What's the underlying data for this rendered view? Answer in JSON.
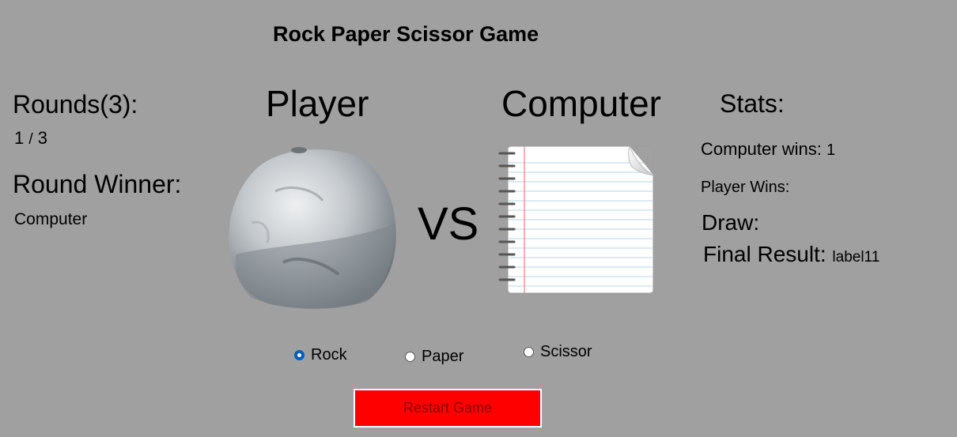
{
  "window": {
    "title": "Rock Paper Scissor Game"
  },
  "left_panel": {
    "rounds_label": "Rounds(3):",
    "rounds_current": "1",
    "rounds_separator": "/",
    "rounds_total": "3",
    "round_winner_label": "Round Winner:",
    "round_winner_value": "Computer"
  },
  "arena": {
    "player_heading": "Player",
    "computer_heading": "Computer",
    "vs_label": "VS",
    "player_choice_image": "rock-image",
    "computer_choice_image": "paper-notepad-image"
  },
  "stats": {
    "heading": "Stats:",
    "computer_wins_label": "Computer wins:",
    "computer_wins_value": "1",
    "player_wins_label": "Player Wins:",
    "player_wins_value": "",
    "draw_label": "Draw:",
    "draw_value": "",
    "final_result_label": "Final Result:",
    "final_result_value": "label11"
  },
  "choices": {
    "options": [
      {
        "label": "Rock",
        "checked": true
      },
      {
        "label": "Paper",
        "checked": false
      },
      {
        "label": "Scissor",
        "checked": false
      }
    ],
    "selected": "Rock"
  },
  "restart_button": {
    "label": "Restart Game"
  },
  "colors": {
    "background": "#a0a0a0",
    "restart_button_bg": "#ff0000",
    "restart_button_text": "#8a0000",
    "radio_checked": "#0060c0"
  }
}
